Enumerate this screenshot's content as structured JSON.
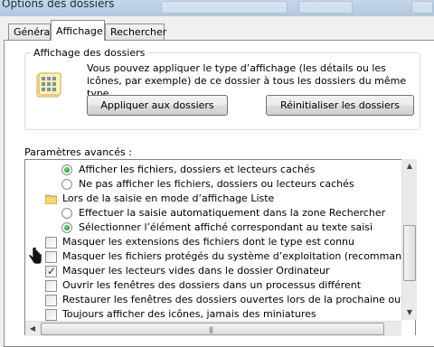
{
  "window": {
    "title": "Options des dossiers"
  },
  "tabs": [
    {
      "label": "Général",
      "active": false
    },
    {
      "label": "Affichage",
      "active": true
    },
    {
      "label": "Rechercher",
      "active": false
    }
  ],
  "folder_views": {
    "heading": "Affichage des dossiers",
    "description": "Vous pouvez appliquer le type d’affichage (les détails ou les icônes, par exemple) de ce dossier à tous les dossiers du même type.",
    "apply_button": "Appliquer aux dossiers",
    "reset_button": "Réinitialiser les dossiers"
  },
  "advanced": {
    "heading": "Paramètres avancés :",
    "items": [
      {
        "kind": "radio",
        "checked": true,
        "label": "Afficher les fichiers, dossiers et lecteurs cachés"
      },
      {
        "kind": "radio",
        "checked": false,
        "label": "Ne pas afficher les fichiers, dossiers ou lecteurs cachés"
      },
      {
        "kind": "folder",
        "label": "Lors de la saisie en mode d’affichage Liste"
      },
      {
        "kind": "radio",
        "checked": false,
        "label": "Effectuer la saisie automatiquement dans la zone Rechercher"
      },
      {
        "kind": "radio",
        "checked": true,
        "label": "Sélectionner l’élément affiché correspondant au texte saisi"
      },
      {
        "kind": "checkbox",
        "checked": false,
        "label": "Masquer les extensions des fichiers dont le type est connu"
      },
      {
        "kind": "checkbox",
        "checked": false,
        "label": "Masquer les fichiers protégés du système d’exploitation (recommandé)"
      },
      {
        "kind": "checkbox",
        "checked": true,
        "label": "Masquer les lecteurs vides dans le dossier Ordinateur"
      },
      {
        "kind": "checkbox",
        "checked": false,
        "label": "Ouvrir les fenêtres des dossiers dans un processus différent"
      },
      {
        "kind": "checkbox",
        "checked": false,
        "label": "Restaurer les fenêtres des dossiers ouvertes lors de la prochaine ouverture de se"
      },
      {
        "kind": "checkbox",
        "checked": false,
        "label": "Toujours afficher des icônes, jamais des miniatures"
      }
    ]
  },
  "icons": {
    "folder_options": "folder-view-icon",
    "folder_small": "folder-icon",
    "cursor": "hand-cursor-icon"
  }
}
